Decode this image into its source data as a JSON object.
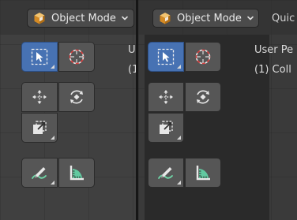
{
  "colors": {
    "active_tool": "#4772b3",
    "tool_button": "#565656",
    "header_dropdown": "#4b4b4b",
    "viewport_bg": "#404040",
    "mode_icon_orange": "#e8a23b",
    "measure_green": "#62c9a0"
  },
  "left_editor": {
    "mode_dropdown": {
      "label": "Object Mode",
      "icon": "object-cube-icon"
    },
    "viewport_overlay": {
      "line1": "U",
      "line2": "(1"
    },
    "tools": [
      {
        "name": "select-box",
        "icon": "select-box-icon",
        "active": true
      },
      {
        "name": "cursor",
        "icon": "cursor-icon",
        "active": false
      },
      {
        "name": "move",
        "icon": "move-icon",
        "active": false
      },
      {
        "name": "rotate",
        "icon": "rotate-icon",
        "active": false
      },
      {
        "name": "scale",
        "icon": "scale-icon",
        "active": false
      },
      {
        "name": "annotate",
        "icon": "annotate-icon",
        "active": false
      },
      {
        "name": "measure",
        "icon": "measure-icon",
        "active": false
      }
    ]
  },
  "right_editor": {
    "mode_dropdown": {
      "label": "Object Mode",
      "icon": "object-cube-icon"
    },
    "menu_next": "Quic",
    "viewport_overlay": {
      "line1": "User Pe",
      "line2": "(1) Coll"
    },
    "tools": [
      {
        "name": "select-box",
        "icon": "select-box-icon",
        "active": true
      },
      {
        "name": "cursor",
        "icon": "cursor-icon",
        "active": false
      },
      {
        "name": "move",
        "icon": "move-icon",
        "active": false
      },
      {
        "name": "rotate",
        "icon": "rotate-icon",
        "active": false
      },
      {
        "name": "scale",
        "icon": "scale-icon",
        "active": false
      },
      {
        "name": "annotate",
        "icon": "annotate-icon",
        "active": false
      },
      {
        "name": "measure",
        "icon": "measure-icon",
        "active": false
      }
    ]
  }
}
